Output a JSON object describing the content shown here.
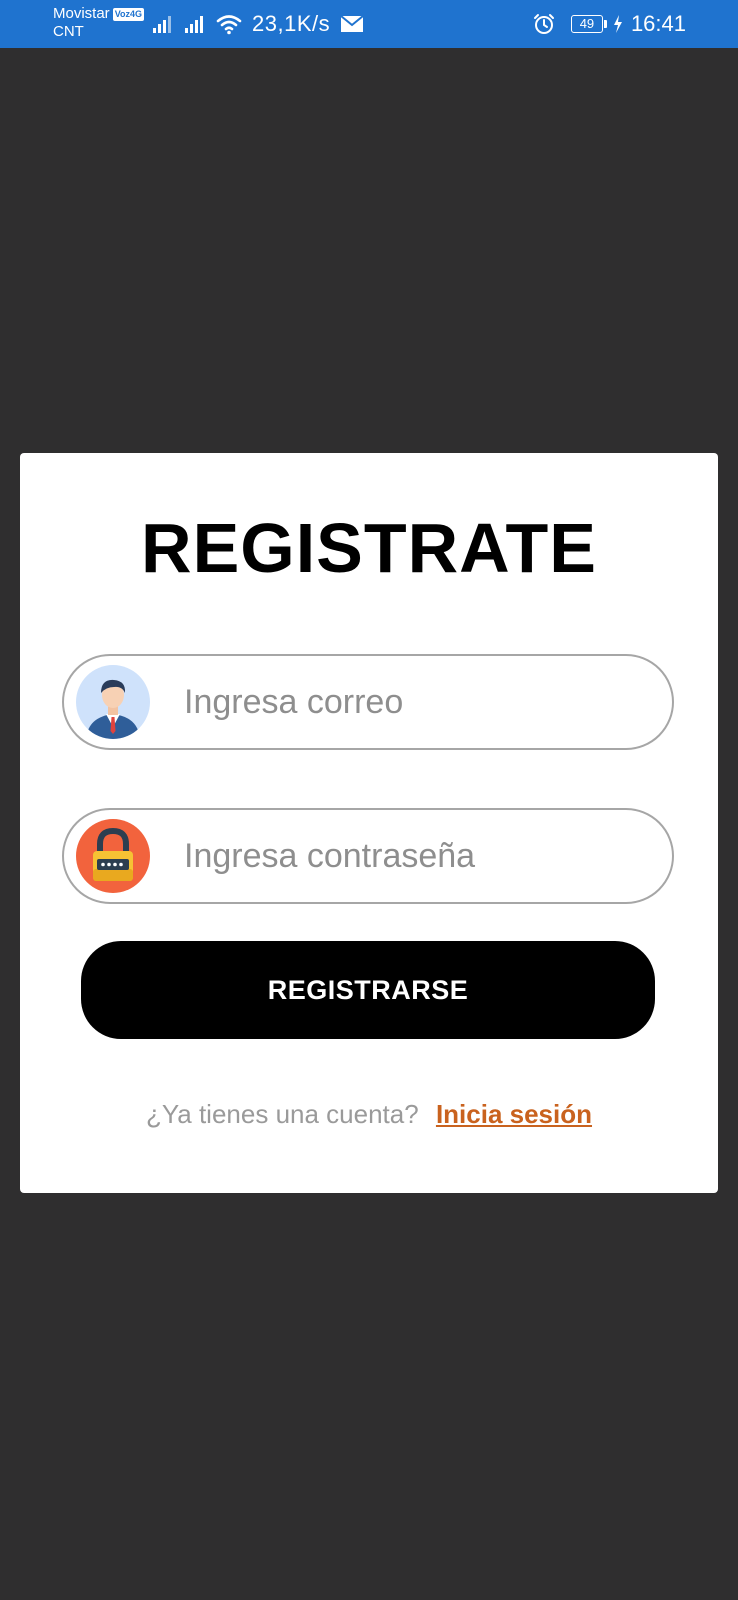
{
  "status_bar": {
    "carrier_1": "Movistar",
    "volte_badge": "Voz4G",
    "carrier_2": "CNT",
    "net_speed": "23,1K/s",
    "battery": "49",
    "time": "16:41",
    "color": "#1f73cf"
  },
  "register_form": {
    "title": "REGISTRATE",
    "email_placeholder": "Ingresa correo",
    "password_placeholder": "Ingresa contraseña",
    "submit_label": "REGISTRARSE",
    "login_prompt": "¿Ya tienes una cuenta?",
    "login_link": "Inicia sesión",
    "link_color": "#c9621e"
  },
  "icons": {
    "email_field_icon": "user-avatar-icon",
    "password_field_icon": "padlock-icon"
  }
}
